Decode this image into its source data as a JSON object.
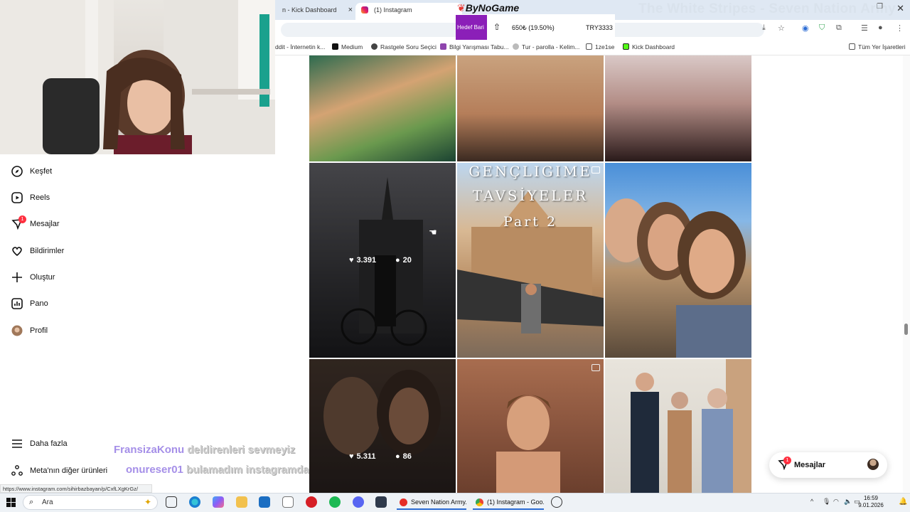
{
  "browser": {
    "tabs": [
      {
        "label": "n - Kick Dashboard",
        "close": "×"
      },
      {
        "label": "(1) Instagram"
      }
    ],
    "window_title_overlay": "The White Stripes - Seven Nation Army",
    "window_controls": {
      "maximize": "❐",
      "close": "✕"
    },
    "bookmarks": [
      "ddit - İnternetin k...",
      "Medium",
      "Rastgele Soru Seçici",
      "Bilgi Yarışması Tabu...",
      "Tur - parolla - Kelim...",
      "1ze1se",
      "Kick Dashboard"
    ],
    "bookmarks_right": "Tüm Yer İşaretleri",
    "status_url": "https://www.instagram.com/sihirbazbayan/p/CxfLXgKrGz/"
  },
  "bynogame": {
    "logo": "ByNoGame",
    "goal_label": "Hedef Bari",
    "amount": "650₺ (19.50%)",
    "total": "TRY3333"
  },
  "sidebar": {
    "items": [
      {
        "label": "Keşfet",
        "icon": "compass-icon"
      },
      {
        "label": "Reels",
        "icon": "reels-icon"
      },
      {
        "label": "Mesajlar",
        "icon": "messenger-icon",
        "badge": "1"
      },
      {
        "label": "Bildirimler",
        "icon": "heart-icon"
      },
      {
        "label": "Oluştur",
        "icon": "plus-icon"
      },
      {
        "label": "Pano",
        "icon": "dashboard-icon"
      },
      {
        "label": "Profil",
        "icon": "avatar-icon"
      }
    ],
    "more": "Daha fazla",
    "meta": "Meta'nın diğer ürünleri"
  },
  "chat": [
    {
      "user": "FransizaKonu",
      "message": "deldirenleri sevmeyiz"
    },
    {
      "user": "onureser01",
      "message": "bulamadım instagramda profili"
    }
  ],
  "posts": {
    "row2_left": {
      "likes": "3.391",
      "comments": "20"
    },
    "row2_middle": {
      "text_line1": "GENÇLIGIME",
      "text_line2": "TAVSİYELER",
      "text_line3": "Part 2"
    },
    "row3_left": {
      "likes": "5.311",
      "comments": "86"
    }
  },
  "messages_pill": {
    "label": "Mesajlar",
    "badge": "1"
  },
  "taskbar": {
    "search_placeholder": "Ara",
    "tasks": [
      "Seven Nation Army...",
      "(1) Instagram - Goo..."
    ],
    "time": "16:59",
    "date": "9.01.2026"
  }
}
